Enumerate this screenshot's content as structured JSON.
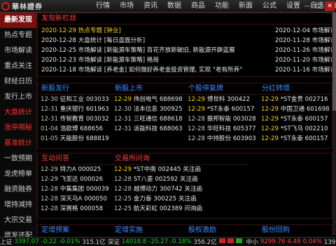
{
  "app": {
    "logo_text": "華林證券"
  },
  "menu": [
    "行情",
    "市场",
    "资讯",
    "数据",
    "商品",
    "功能",
    "新面",
    "公式",
    "设置",
    "自选",
    "自选"
  ],
  "sidebar": [
    "最新发现",
    "热点专题",
    "市场解读",
    "重点关注",
    "财经日历",
    "发行上市",
    "大盘统计",
    "涨停揭秘",
    "基准统计",
    "一致预期",
    "龙虎榜单",
    "融资融券",
    "增持减持",
    "大宗交易",
    "增发还配"
  ],
  "colors": {
    "accent_red": "#ff3030",
    "title_blue": "#3a8cff",
    "date_yellow": "#ffd21e",
    "up": "#ff3b3b",
    "down": "#18c818"
  },
  "news": {
    "title": "发现新栏目",
    "left": [
      "2020-12-29 热点专题 [钟业]",
      "2020-12-28 大盘统计 [每日盘面分析]",
      "2020-12-25 市场解读 [新能源车策略] 百花齐放新破旧, 新能源开辟蓝展",
      "2020-12-23 市场解读 [新能源车策略] 格局",
      "2020-12-18 市场解读 [养老金] 如何做好养老金投资管理, 实现 \"老有所养\""
    ],
    "right": [
      "2020-12-04 市场解读 [智",
      "2020-11-28 市场解读 [扬",
      "2020-11-26 市场解读 [抗",
      "2020-11-20 市场解读 [报",
      "2020-11-16 市场解读 [跨"
    ]
  },
  "sections_a": [
    {
      "title": "新股发行",
      "rows": [
        {
          "date": "12-30",
          "name": "征和工业 003033"
        },
        {
          "date": "12-31",
          "name": "重庆银行 601963"
        },
        {
          "date": "12-31",
          "name": "传智教育 003032"
        },
        {
          "date": "01-04",
          "name": "浩欧博 688656"
        },
        {
          "date": "01-05",
          "name": "天能股份 688819"
        }
      ]
    },
    {
      "title": "新股上市",
      "rows": [
        {
          "date": "12-29",
          "name": "伟创电气 688698"
        },
        {
          "date": "12-30",
          "name": "法本信息 300925"
        },
        {
          "date": "12-31",
          "name": "三旺通信 688618"
        },
        {
          "date": "12-31",
          "name": "派能科技 688063"
        }
      ]
    },
    {
      "title": "个股停复牌",
      "rows": [
        {
          "date": "12-29",
          "name": "博世科 300422"
        },
        {
          "date": "12-29",
          "name": "*ST永泰 600157"
        },
        {
          "date": "12-28",
          "name": "振邦智能 003028"
        },
        {
          "date": "12-28",
          "name": "华旺科技 605377"
        },
        {
          "date": "12-28",
          "name": "中持股份 603903"
        }
      ]
    },
    {
      "title": "分红转增",
      "rows": [
        {
          "date": "12-29",
          "name": "*ST金贵 002716"
        },
        {
          "date": "12-29",
          "name": "中国卫通 601698"
        },
        {
          "date": "12-29",
          "name": "*ST永泰 600157"
        },
        {
          "date": "12-29",
          "name": "*ST飞马 002210"
        },
        {
          "date": "12-29",
          "name": "*ST永泰 600157"
        }
      ]
    }
  ],
  "sections_b": [
    {
      "title": "互动问答",
      "rows": [
        {
          "date": "12-29",
          "name": "特力A 000025"
        },
        {
          "date": "12-29",
          "name": "飞亚达 000026"
        },
        {
          "date": "12-28",
          "name": "中集集团 000039"
        },
        {
          "date": "12-28",
          "name": "深天马A 000050"
        },
        {
          "date": "12-28",
          "name": "深赛格 000058"
        }
      ]
    },
    {
      "title": "交易所问询",
      "rows": [
        {
          "date": "12-29",
          "name": "*ST中南 002445 关注函"
        },
        {
          "date": "12-28",
          "name": "ST八菱 002592 关注函"
        },
        {
          "date": "12-28",
          "name": "越博动力 300742 关注函"
        },
        {
          "date": "12-25",
          "name": "金力泰 300225 关注函"
        },
        {
          "date": "12-25",
          "name": "航天彩虹 002389 问询函"
        }
      ]
    }
  ],
  "sections_c": [
    "定增预案",
    "定增实施",
    "股权激励",
    "股份回购"
  ],
  "status": {
    "sh_label": "上证",
    "sh_value": "3397.07",
    "sh_change": "-0.22",
    "sh_pct": "-0.01%",
    "sh_amt": "315.1亿",
    "sz_label": "深证",
    "sz_value": "14018.8",
    "sz_change": "-25.27",
    "sz_pct": "-0.18%",
    "sz_amt": "356.2亿",
    "zx_label": "中小",
    "zx_value": "9299.76",
    "zx_change": "4.48",
    "zx_pct": "0.04%",
    "zx_amt": "139.3亿"
  }
}
